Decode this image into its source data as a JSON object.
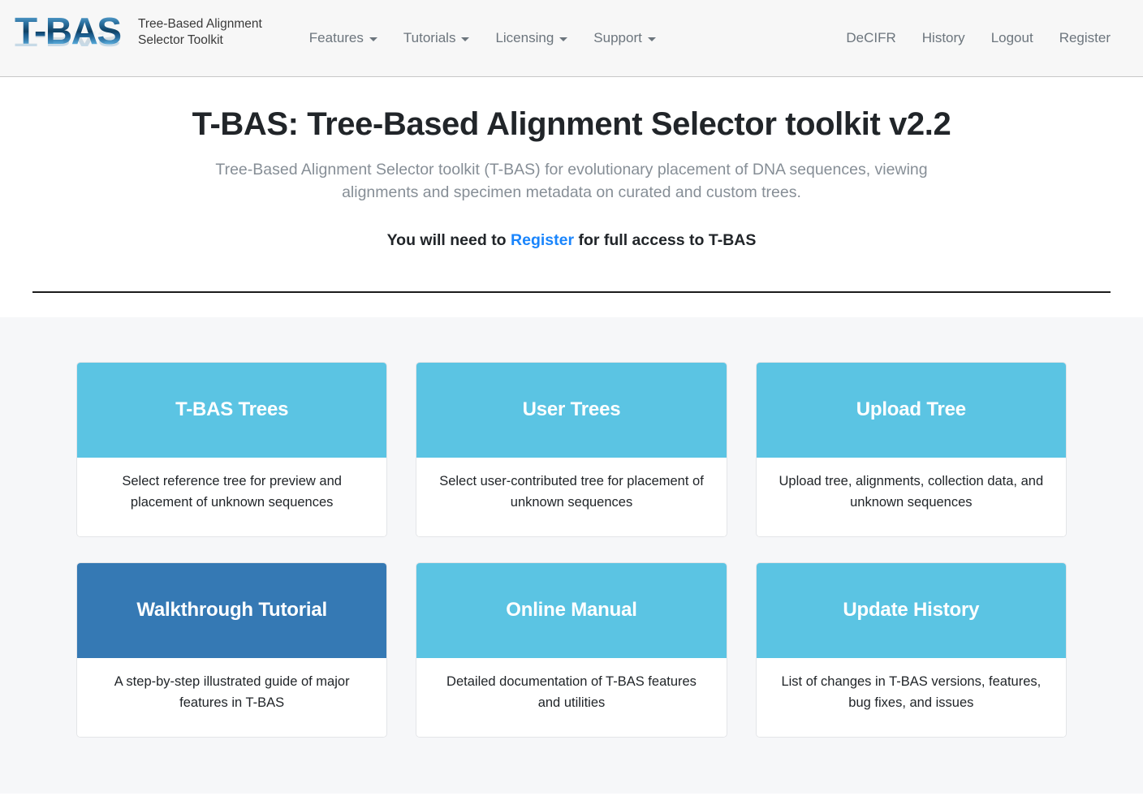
{
  "brand": {
    "logo_text": "T-BAS",
    "tagline": "Tree-Based Alignment\nSelector Toolkit"
  },
  "nav": {
    "left_items": [
      {
        "label": "Features",
        "has_dropdown": true
      },
      {
        "label": "Tutorials",
        "has_dropdown": true
      },
      {
        "label": "Licensing",
        "has_dropdown": true
      },
      {
        "label": "Support",
        "has_dropdown": true
      }
    ],
    "right_items": [
      {
        "label": "DeCIFR"
      },
      {
        "label": "History"
      },
      {
        "label": "Logout"
      },
      {
        "label": "Register"
      }
    ]
  },
  "hero": {
    "title": "T-BAS: Tree-Based Alignment Selector toolkit v2.2",
    "subtitle": "Tree-Based Alignment Selector toolkit (T-BAS) for evolutionary placement of DNA sequences, viewing alignments and specimen metadata on curated and custom trees.",
    "cta_prefix": "You will need to ",
    "cta_link": "Register",
    "cta_suffix": " for full access to T-BAS"
  },
  "cards": [
    {
      "title": "T-BAS Trees",
      "description": "Select reference tree for preview and placement of unknown sequences",
      "state": "default"
    },
    {
      "title": "User Trees",
      "description": "Select user-contributed tree for placement of unknown sequences",
      "state": "default"
    },
    {
      "title": "Upload Tree",
      "description": "Upload tree, alignments, collection data, and unknown sequences",
      "state": "default"
    },
    {
      "title": "Walkthrough Tutorial",
      "description": "A step-by-step illustrated guide of major features in T-BAS",
      "state": "active"
    },
    {
      "title": "Online Manual",
      "description": "Detailed documentation of T-BAS features and utilities",
      "state": "default"
    },
    {
      "title": "Update History",
      "description": "List of changes in T-BAS versions, features, bug fixes, and issues",
      "state": "default"
    }
  ],
  "colors": {
    "card_header": "#5bc4e3",
    "card_header_active": "#3579b4",
    "link_blue": "#1a85fc",
    "section_background": "#f6f7f9",
    "navbar_background": "#f7f7f7",
    "muted_text": "#868e96"
  },
  "icons": {
    "dropdown_caret": "chevron-down-icon"
  }
}
